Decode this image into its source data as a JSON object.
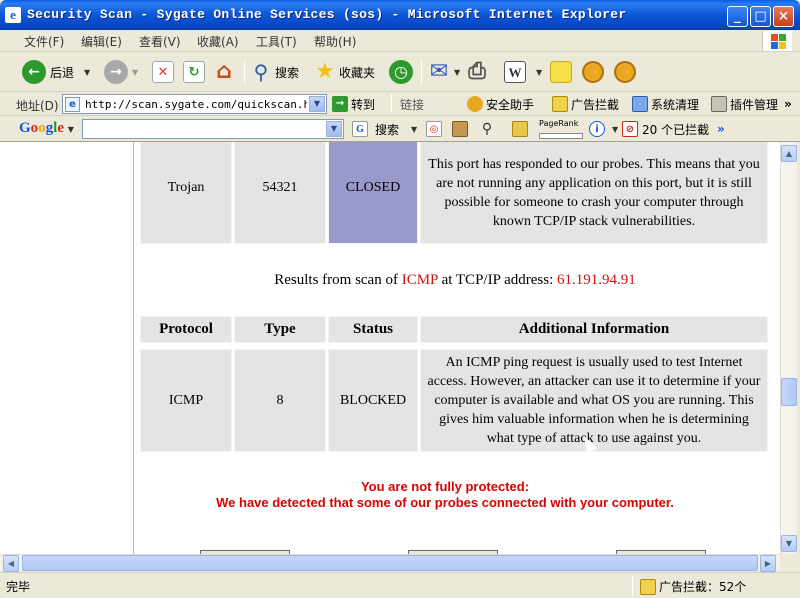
{
  "window": {
    "title": "Security Scan - Sygate Online Services (sos) - Microsoft Internet Explorer",
    "app_icon_glyph": "e",
    "minimize_glyph": "_",
    "maximize_glyph": "□",
    "close_glyph": "×"
  },
  "menu": {
    "items": [
      "文件(F)",
      "编辑(E)",
      "查看(V)",
      "收藏(A)",
      "工具(T)",
      "帮助(H)"
    ]
  },
  "toolbar": {
    "back_label": "后退",
    "search_label": "搜索",
    "favorites_label": "收藏夹",
    "icons": {
      "back": "←",
      "forward": "→",
      "stop": "✕",
      "refresh": "↻",
      "home": "⌂",
      "search": "⚲",
      "favorites": "★",
      "history": "◷",
      "mail": "✉",
      "print": "⎙",
      "edit": "W",
      "messenger": "■"
    },
    "colors": {
      "back": "#2c9a2c",
      "forward": "#a0a0a0",
      "stop": "#d83a2a",
      "star": "#f2c21a"
    }
  },
  "address": {
    "label": "地址(D)",
    "url": "http://scan.sygate.com/quickscan.html",
    "go_label": "转到",
    "links_label": "链接",
    "helper_label": "安全助手",
    "ad_block_label": "广告拦截",
    "cleanup_label": "系统清理",
    "plugin_label": "插件管理",
    "more": "»"
  },
  "google_bar": {
    "logo": [
      "G",
      "o",
      "o",
      "g",
      "l",
      "e"
    ],
    "logo_colors": [
      "#1a55d6",
      "#d62a1a",
      "#e8a800",
      "#1a55d6",
      "#1a9a2a",
      "#d62a1a"
    ],
    "input_value": "",
    "search_label": "搜索",
    "pagerank_label": "PageRank",
    "pagerank_fill": 0,
    "blocked_label": "20 个已拦截",
    "more": "»"
  },
  "scan": {
    "trojan_row": {
      "protocol": "Trojan",
      "port": "54321",
      "status": "CLOSED",
      "info": "This port has responded to our probes. This means that you are not running any application on this port, but it is still possible for someone to crash your computer through known TCP/IP stack vulnerabilities."
    },
    "results_prefix": "Results from scan of ",
    "results_protocol": "ICMP",
    "results_middle": " at TCP/IP address: ",
    "results_ip": "61.191.94.91",
    "headers": {
      "protocol": "Protocol",
      "type": "Type",
      "status": "Status",
      "info": "Additional Information"
    },
    "icmp_row": {
      "protocol": "ICMP",
      "type": "8",
      "status": "BLOCKED",
      "info": "An ICMP ping request is usually used to test Internet access. However, an attacker can use it to determine if your computer is available and what OS you are running. This gives him valuable information when he is determining what type of attack to use against you."
    },
    "warning_line1": "You are not fully protected:",
    "warning_line2": "We have detected that some of our probes connected with your computer."
  },
  "status": {
    "left": "完毕",
    "ad_blocked": "广告拦截：52个"
  },
  "colors": {
    "closed_cell": "#9999cc",
    "cell_bg": "#e4e4e4",
    "warning": "#dd0000",
    "highlight": "#cc1111"
  }
}
